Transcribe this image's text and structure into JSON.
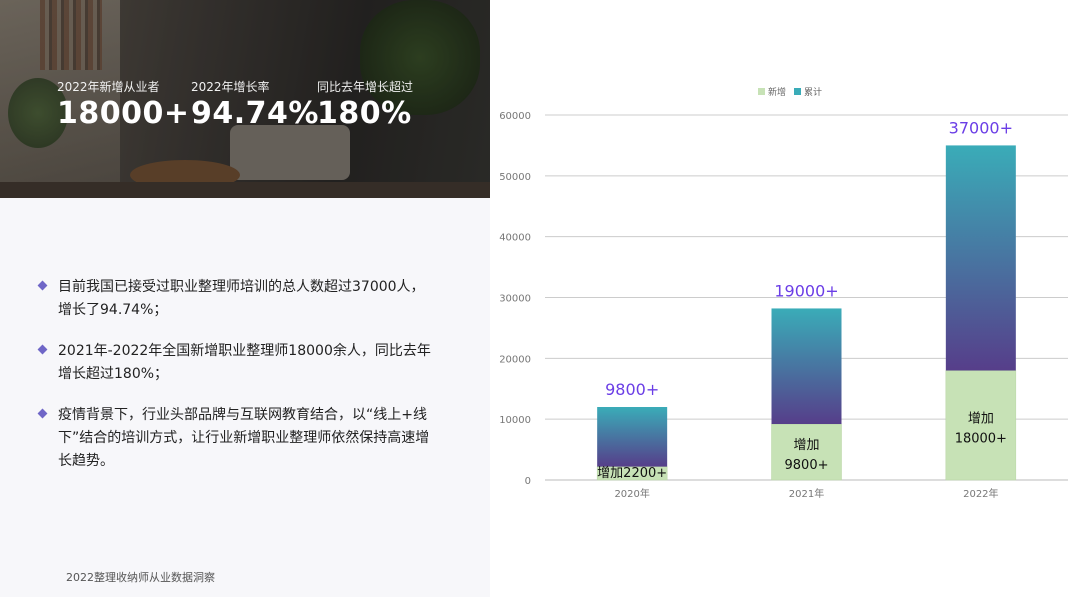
{
  "stats": [
    {
      "label": "2022年新增从业者",
      "value": "18000+"
    },
    {
      "label": "2022年增长率",
      "value": "94.74%"
    },
    {
      "label": "同比去年增长超过",
      "value": "180%"
    }
  ],
  "bullets": [
    {
      "text": "目前我国已接受过职业整理师培训的总人数超过37000人，增长了94.74%；"
    },
    {
      "text": "2021年-2022年全国新增职业整理师18000余人，同比去年增长超过180%；"
    },
    {
      "text": "疫情背景下，行业头部品牌与互联网教育结合，以“线上+线下”结合的培训方式，让行业新增职业整理师依然保持高速增长趋势。"
    }
  ],
  "footer": {
    "text": "2022整理收纳师从业数据洞察"
  },
  "chart_data": {
    "type": "bar",
    "stacked": true,
    "categories": [
      "2020年",
      "2021年",
      "2022年"
    ],
    "series": [
      {
        "name": "新增",
        "values": [
          2200,
          9200,
          18000
        ],
        "color": "#c7e2b6"
      },
      {
        "name": "累计",
        "values": [
          9800,
          19000,
          37000
        ],
        "color": "#3aacb8"
      }
    ],
    "labels_new": [
      [
        "增加2200+"
      ],
      [
        "增加",
        "9800+"
      ],
      [
        "增加",
        "18000+"
      ]
    ],
    "labels_total": [
      "9800+",
      "19000+",
      "37000+"
    ],
    "yticks": [
      0,
      10000,
      20000,
      30000,
      40000,
      50000,
      60000
    ],
    "ylim": [
      0,
      60000
    ],
    "legend_position": "top",
    "grid": true,
    "colors": {
      "accent": "#6b3ee6",
      "gradient_top": "#3aacb8",
      "gradient_bottom": "#563e8a"
    }
  }
}
